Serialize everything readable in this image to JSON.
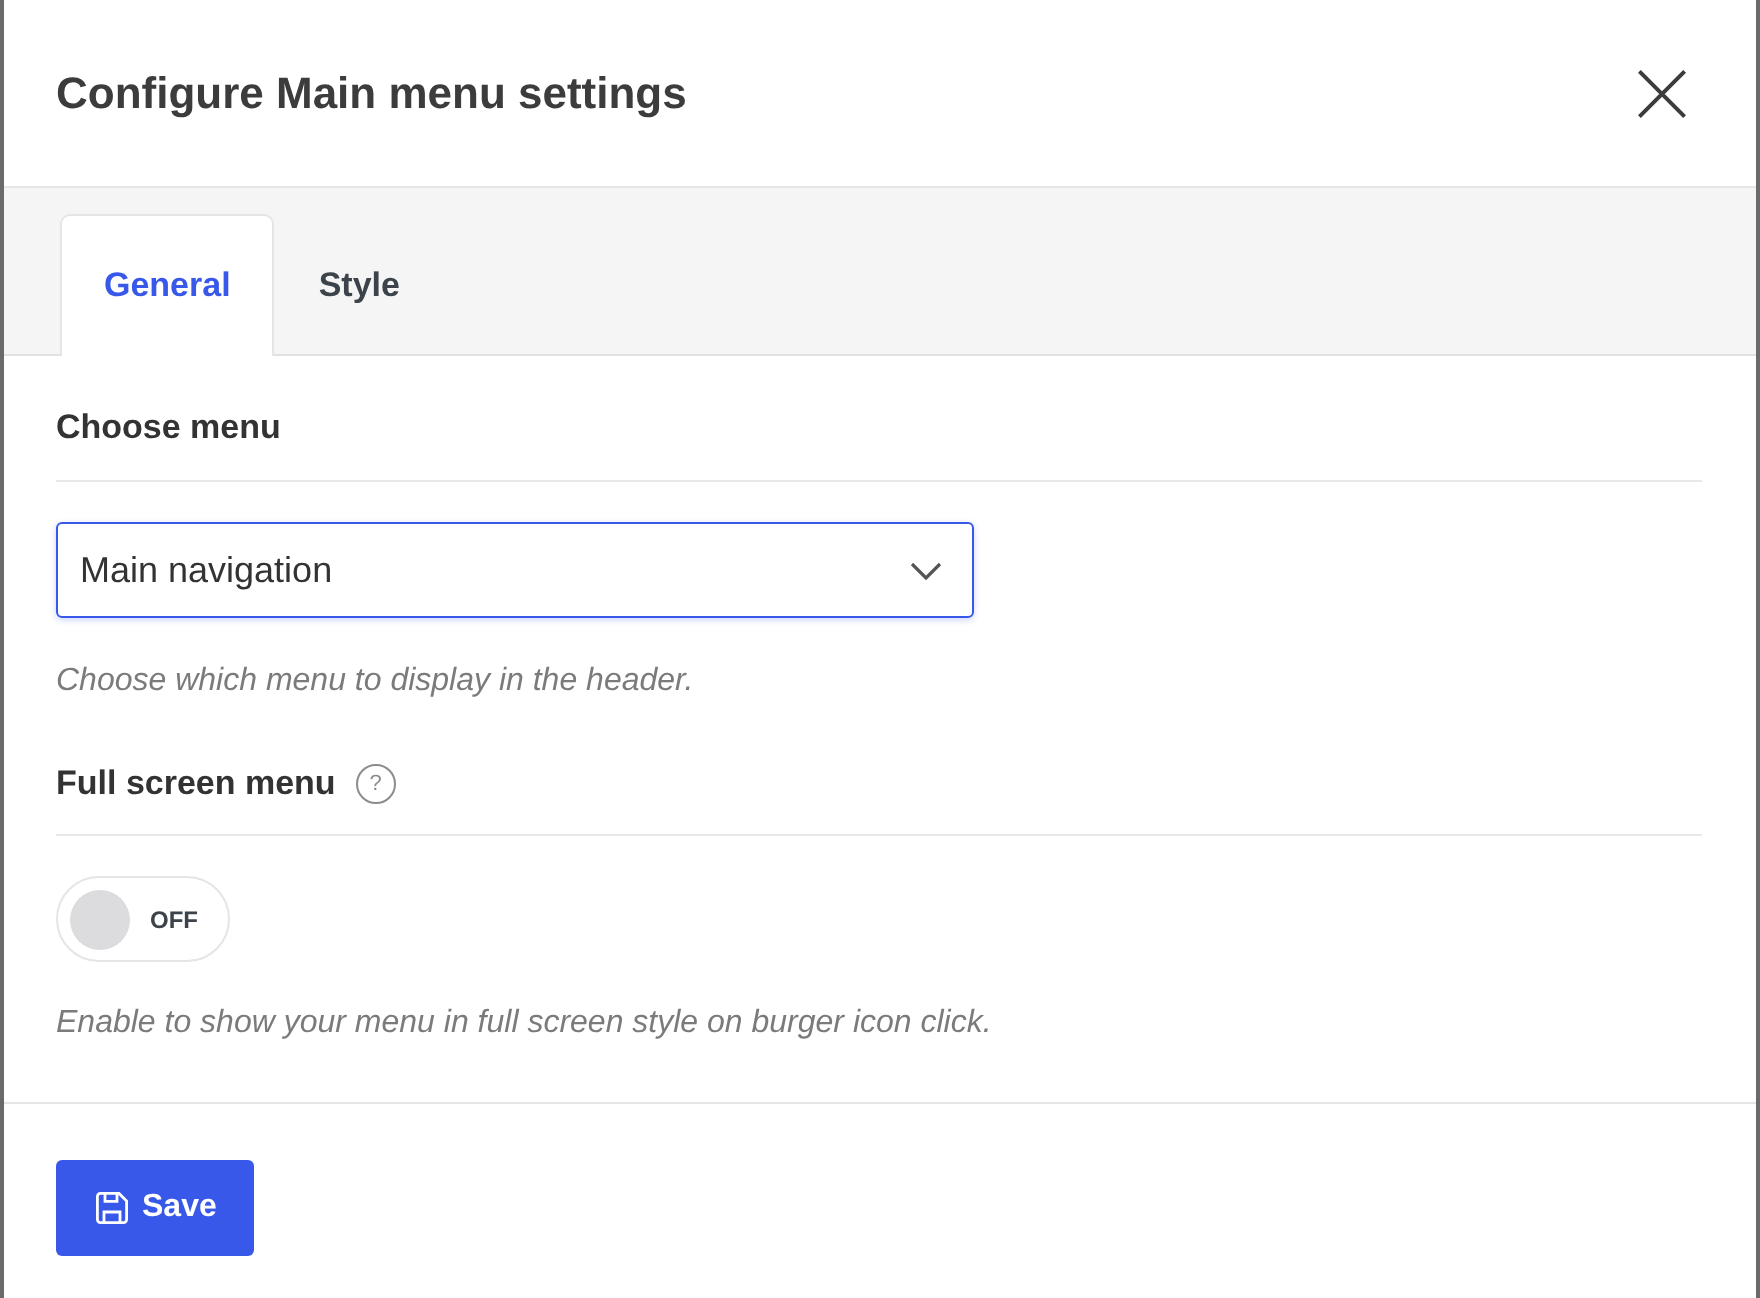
{
  "dialog": {
    "title": "Configure Main menu settings"
  },
  "tabs": [
    {
      "label": "General",
      "selected": true
    },
    {
      "label": "Style",
      "selected": false
    }
  ],
  "fields": [
    {
      "kind": "select",
      "label": "Choose menu",
      "value": "Main navigation",
      "help": "Choose which menu to display in the header."
    },
    {
      "kind": "toggle",
      "label": "Full screen menu",
      "help_mark": "?",
      "on": false,
      "state_label": "OFF",
      "help": "Enable to show your menu in full screen style on burger icon click."
    }
  ],
  "buttons": [
    {
      "label": "Save"
    }
  ]
}
